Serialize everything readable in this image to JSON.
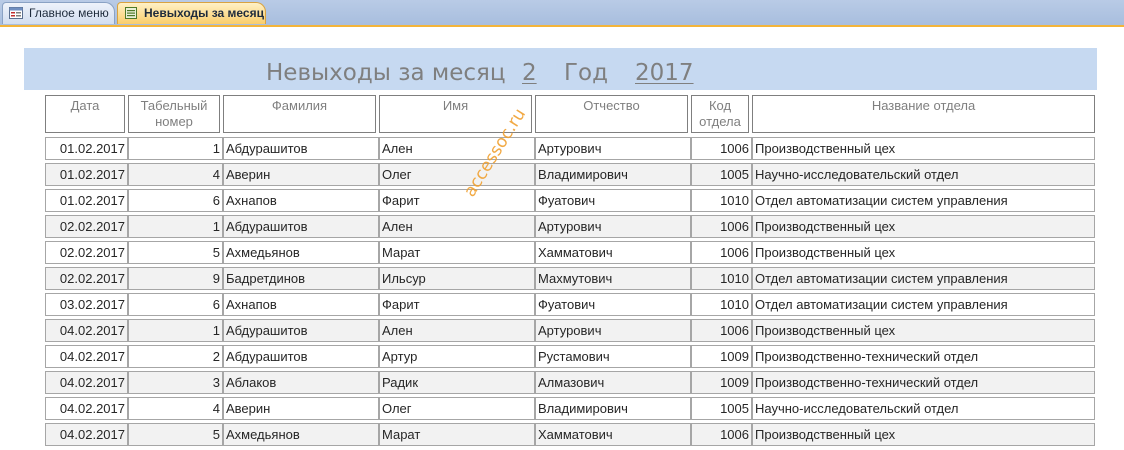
{
  "tabs": [
    {
      "label": "Главное меню",
      "icon": "form-icon"
    },
    {
      "label": "Невыходы за месяц",
      "icon": "report-icon"
    }
  ],
  "header": {
    "title": "Невыходы за месяц",
    "month": "2",
    "year_label": "Год",
    "year": "2017"
  },
  "columns": [
    "Дата",
    "Табельный номер",
    "Фамилия",
    "Имя",
    "Отчество",
    "Код отдела",
    "Название отдела"
  ],
  "rows": [
    {
      "date": "01.02.2017",
      "tab": "1",
      "last": "Абдурашитов",
      "first": "Ален",
      "middle": "Артурович",
      "code": "1006",
      "dept": "Производственный цех"
    },
    {
      "date": "01.02.2017",
      "tab": "4",
      "last": "Аверин",
      "first": "Олег",
      "middle": "Владимирович",
      "code": "1005",
      "dept": "Научно-исследовательский отдел"
    },
    {
      "date": "01.02.2017",
      "tab": "6",
      "last": "Ахнапов",
      "first": "Фарит",
      "middle": "Фуатович",
      "code": "1010",
      "dept": "Отдел автоматизации систем управления"
    },
    {
      "date": "02.02.2017",
      "tab": "1",
      "last": "Абдурашитов",
      "first": "Ален",
      "middle": "Артурович",
      "code": "1006",
      "dept": "Производственный цех"
    },
    {
      "date": "02.02.2017",
      "tab": "5",
      "last": "Ахмедьянов",
      "first": "Марат",
      "middle": "Хамматович",
      "code": "1006",
      "dept": "Производственный цех"
    },
    {
      "date": "02.02.2017",
      "tab": "9",
      "last": "Бадретдинов",
      "first": "Ильсур",
      "middle": "Махмутович",
      "code": "1010",
      "dept": "Отдел автоматизации систем управления"
    },
    {
      "date": "03.02.2017",
      "tab": "6",
      "last": "Ахнапов",
      "first": "Фарит",
      "middle": "Фуатович",
      "code": "1010",
      "dept": "Отдел автоматизации систем управления"
    },
    {
      "date": "04.02.2017",
      "tab": "1",
      "last": "Абдурашитов",
      "first": "Ален",
      "middle": "Артурович",
      "code": "1006",
      "dept": "Производственный цех"
    },
    {
      "date": "04.02.2017",
      "tab": "2",
      "last": "Абдурашитов",
      "first": "Артур",
      "middle": "Рустамович",
      "code": "1009",
      "dept": "Производственно-технический отдел"
    },
    {
      "date": "04.02.2017",
      "tab": "3",
      "last": "Аблаков",
      "first": "Радик",
      "middle": "Алмазович",
      "code": "1009",
      "dept": "Производственно-технический отдел"
    },
    {
      "date": "04.02.2017",
      "tab": "4",
      "last": "Аверин",
      "first": "Олег",
      "middle": "Владимирович",
      "code": "1005",
      "dept": "Научно-исследовательский отдел"
    },
    {
      "date": "04.02.2017",
      "tab": "5",
      "last": "Ахмедьянов",
      "first": "Марат",
      "middle": "Хамматович",
      "code": "1006",
      "dept": "Производственный цех"
    }
  ],
  "watermark": "accessoc.ru",
  "colors": {
    "header_band": "#c6d9f1",
    "active_tab": "#f9cd6b",
    "watermark": "#f0a030"
  }
}
